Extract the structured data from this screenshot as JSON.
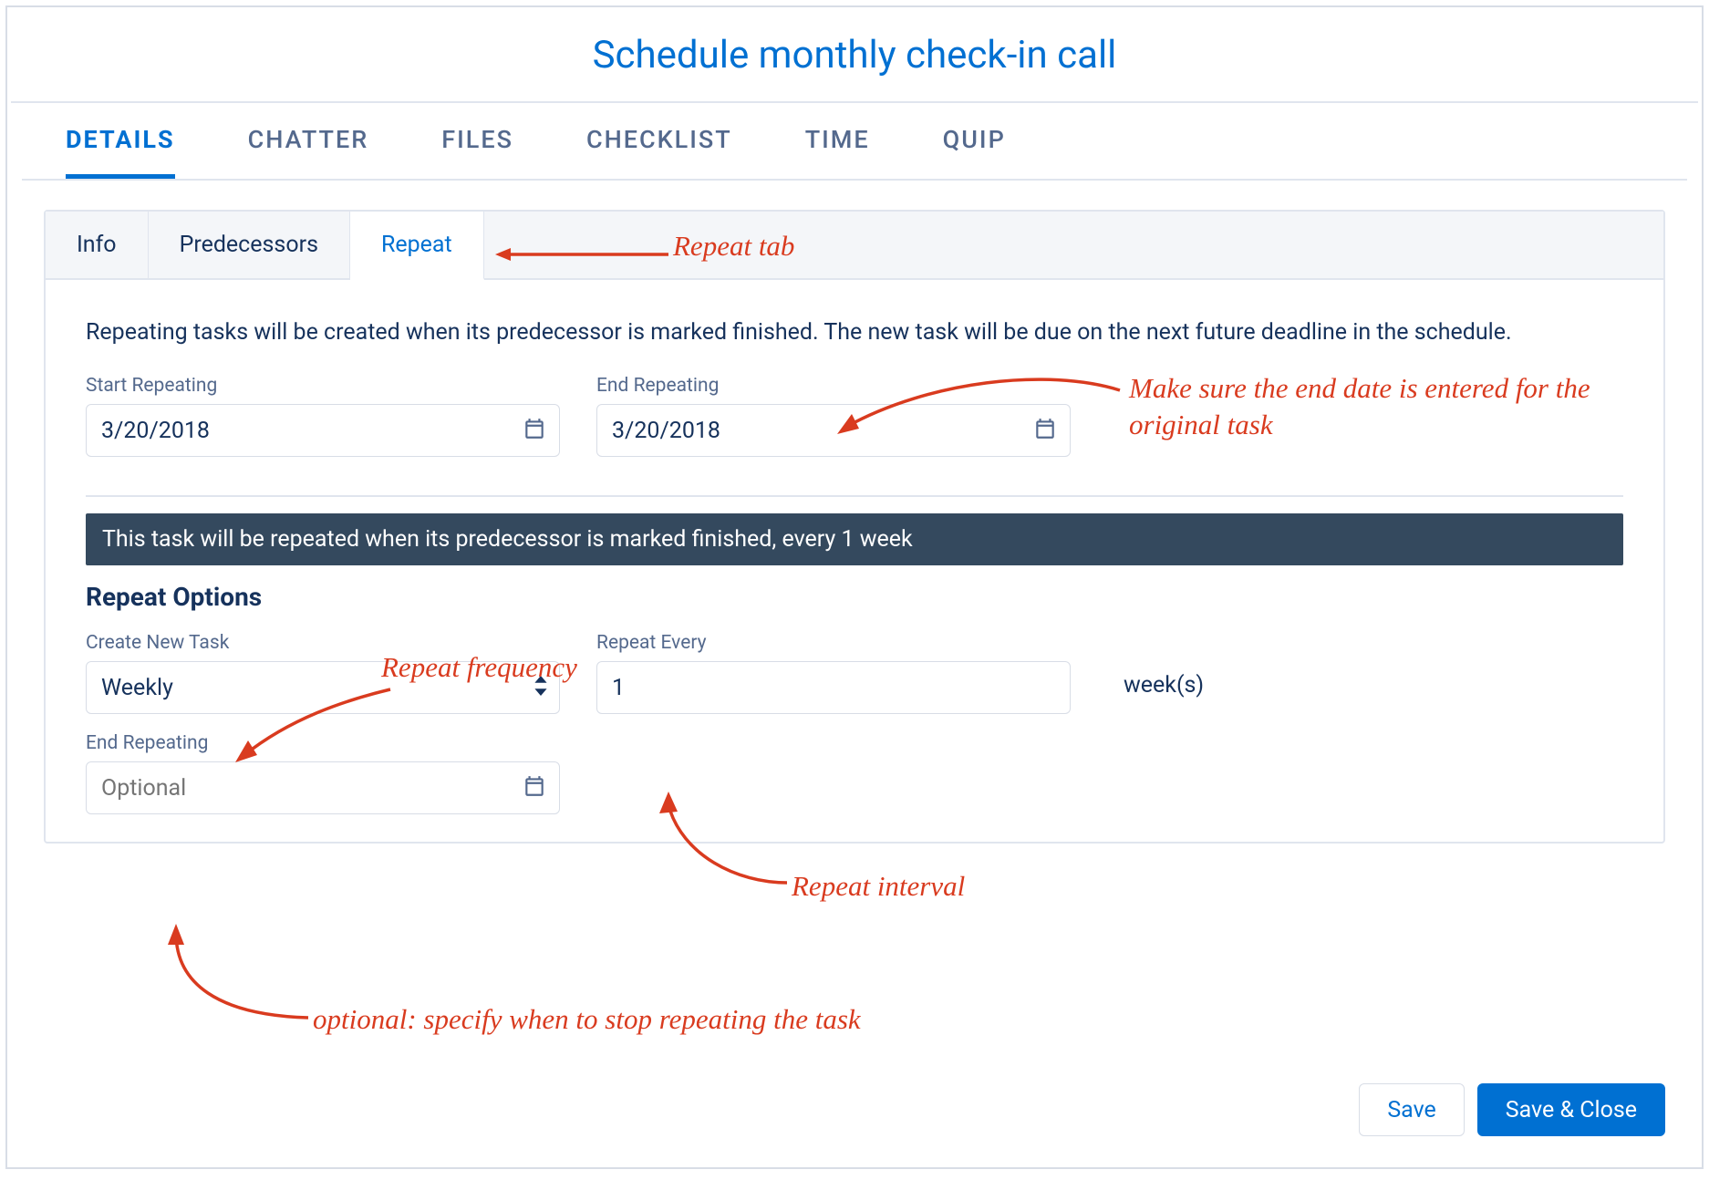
{
  "title": "Schedule monthly check-in call",
  "main_tabs": {
    "details": "DETAILS",
    "chatter": "CHATTER",
    "files": "FILES",
    "checklist": "CHECKLIST",
    "time": "TIME",
    "quip": "QUIP"
  },
  "sub_tabs": {
    "info": "Info",
    "predecessors": "Predecessors",
    "repeat": "Repeat"
  },
  "description": "Repeating tasks will be created when its predecessor is marked finished. The new task will be due on the next future deadline in the schedule.",
  "start": {
    "label": "Start Repeating",
    "value": "3/20/2018"
  },
  "end": {
    "label": "End Repeating",
    "value": "3/20/2018"
  },
  "summary": "This task will be repeated when its predecessor is marked finished, every 1 week",
  "options_heading": "Repeat Options",
  "create_new": {
    "label": "Create New Task",
    "value": "Weekly"
  },
  "repeat_every": {
    "label": "Repeat Every",
    "value": "1",
    "unit": "week(s)"
  },
  "end_opt": {
    "label": "End Repeating",
    "placeholder": "Optional"
  },
  "buttons": {
    "save": "Save",
    "save_close": "Save & Close"
  },
  "annotations": {
    "repeat_tab": "Repeat tab",
    "end_date": "Make sure the end date is entered for the original task",
    "freq": "Repeat frequency",
    "interval": "Repeat interval",
    "stop": "optional: specify when to stop repeating the task"
  }
}
